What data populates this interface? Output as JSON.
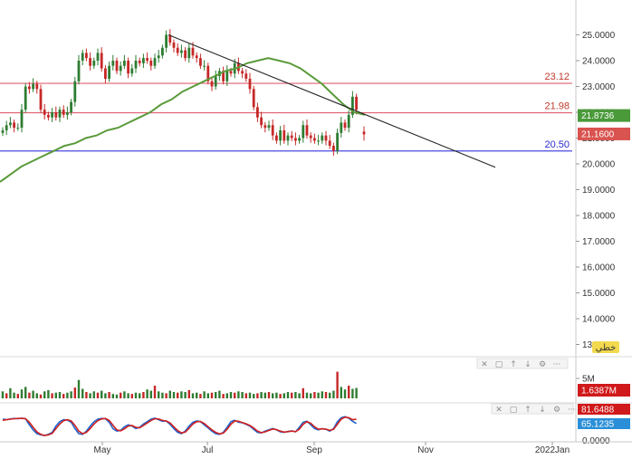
{
  "colors": {
    "candle_up": "#2e7d32",
    "candle_down": "#c62828",
    "ma_line": "#5a9a3a",
    "trend_line": "#222222",
    "resistance": "#e06070",
    "support": "#4a4ae0",
    "stoch_k": "#1e66d0",
    "stoch_d": "#d02020",
    "tag_ma": "#4a9a3a",
    "tag_price": "#d9534f",
    "tag_vol": "#d0191a",
    "tag_stoch1": "#d0191a",
    "tag_stoch2": "#2a8fd8"
  },
  "toolbar": {
    "mode_label": "خطي",
    "icons": [
      "close-icon",
      "maximize-icon",
      "move-up-icon",
      "move-down-icon",
      "settings-icon",
      "more-icon"
    ]
  },
  "chart_data": [
    {
      "type": "candlestick",
      "title": "",
      "ylim": [
        12.8,
        25.6
      ],
      "y_ticks": [
        "25.0000",
        "24.0000",
        "23.0000",
        "22.0000",
        "21.0000",
        "20.0000",
        "19.0000",
        "18.0000",
        "17.0000",
        "16.0000",
        "15.0000",
        "14.0000",
        "13.0000"
      ],
      "y_tick_values": [
        25,
        24,
        23,
        22,
        21,
        20,
        19,
        18,
        17,
        16,
        15,
        14,
        13
      ],
      "x_ticks": [
        "May",
        "Jul",
        "Sep",
        "Nov",
        "2022Jan"
      ],
      "series": [
        {
          "name": "",
          "kind": "ohlc",
          "close": [
            21.3,
            21.5,
            21.6,
            21.4,
            21.4,
            22.1,
            23.0,
            22.9,
            23.1,
            22.9,
            22.1,
            21.9,
            21.8,
            22.0,
            21.8,
            22.1,
            21.9,
            22.0,
            22.4,
            23.2,
            24.0,
            24.3,
            24.1,
            23.8,
            24.0,
            24.3,
            23.7,
            23.3,
            23.8,
            24.0,
            23.6,
            23.8,
            24.0,
            23.5,
            23.7,
            24.0,
            23.9,
            24.1,
            24.0,
            23.8,
            24.1,
            24.2,
            24.5,
            25.0,
            24.7,
            24.5,
            24.3,
            24.4,
            24.1,
            24.5,
            24.2,
            24.1,
            23.8,
            23.8,
            23.2,
            23.0,
            23.4,
            23.6,
            23.2,
            23.6,
            23.5,
            23.9,
            23.6,
            23.5,
            23.3,
            22.9,
            22.2,
            21.8,
            21.5,
            21.4,
            21.5,
            21.1,
            20.9,
            21.3,
            20.9,
            21.1,
            21.0,
            20.9,
            21.0,
            21.5,
            21.1,
            21.0,
            20.9,
            20.9,
            21.1,
            20.9,
            20.7,
            20.5,
            21.2,
            21.6,
            21.4,
            21.9,
            22.6,
            22.1
          ],
          "last": 21.16
        },
        {
          "name": "",
          "kind": "moving_average",
          "values": [
            19.3,
            19.6,
            19.9,
            20.1,
            20.3,
            20.5,
            20.7,
            20.8,
            21.0,
            21.1,
            21.3,
            21.4,
            21.6,
            21.8,
            22.0,
            22.3,
            22.5,
            22.8,
            23.0,
            23.2,
            23.4,
            23.6,
            23.7,
            23.9,
            24.0,
            24.1,
            24.0,
            23.9,
            23.7,
            23.4,
            23.1,
            22.7,
            22.3,
            22.0,
            21.9
          ],
          "last": 21.8736
        },
        {
          "name": "",
          "kind": "trend_line",
          "points": [
            {
              "x": "2021-06-07",
              "y": 25.0
            },
            {
              "x": "2021-10-25",
              "y": 19.8
            }
          ]
        }
      ],
      "annotations": [
        {
          "label": "23.12",
          "value": 23.12,
          "kind": "resistance"
        },
        {
          "label": "21.98",
          "value": 21.98,
          "kind": "resistance"
        },
        {
          "label": "20.50",
          "value": 20.5,
          "kind": "support"
        }
      ],
      "tags": [
        "21.8736",
        "21.1600"
      ]
    },
    {
      "type": "bar",
      "title": "",
      "ylim": [
        0,
        6
      ],
      "y_ticks": [
        "5M"
      ],
      "series": [
        {
          "name": "",
          "values": [
            1.1,
            0.8,
            1.6,
            0.9,
            0.7,
            1.4,
            1.8,
            0.9,
            1.2,
            0.8,
            0.6,
            1.1,
            1.3,
            0.8,
            0.9,
            1.0,
            0.7,
            0.9,
            1.1,
            1.7,
            2.9,
            1.5,
            1.0,
            0.8,
            1.1,
            0.9,
            1.2,
            0.8,
            1.0,
            0.7,
            0.6,
            0.9,
            1.1,
            0.8,
            0.7,
            0.9,
            0.8,
            1.0,
            1.4,
            1.2,
            2.0,
            1.1,
            0.9,
            0.8,
            1.2,
            1.0,
            0.9,
            1.1,
            1.0,
            1.3,
            0.8,
            0.9,
            0.7,
            1.1,
            0.8,
            0.9,
            1.0,
            1.2,
            0.7,
            0.8,
            1.0,
            0.9,
            1.1,
            1.0,
            0.8,
            0.9,
            0.7,
            0.8,
            1.0,
            0.9,
            1.0,
            0.8,
            0.9,
            0.7,
            0.8,
            1.0,
            0.9,
            1.0,
            0.8,
            1.6,
            0.9,
            0.8,
            1.0,
            0.9,
            1.1,
            1.0,
            0.9,
            1.2,
            4.2,
            1.8,
            1.4,
            2.0,
            1.5,
            1.64
          ]
        }
      ],
      "tags": [
        "1.6387M"
      ]
    },
    {
      "type": "line",
      "title": "",
      "ylim": [
        0,
        100
      ],
      "y_ticks": [
        "0.0000"
      ],
      "series": [
        {
          "name": "",
          "values": [
            82,
            80,
            83,
            85,
            84,
            86,
            84,
            60,
            40,
            25,
            20,
            18,
            22,
            30,
            55,
            72,
            80,
            79,
            70,
            45,
            25,
            22,
            35,
            55,
            72,
            82,
            85,
            84,
            70,
            45,
            35,
            38,
            52,
            60,
            55,
            45,
            50,
            63,
            72,
            82,
            86,
            80,
            74,
            75,
            62,
            45,
            30,
            25,
            35,
            55,
            70,
            75,
            72,
            60,
            48,
            35,
            25,
            22,
            30,
            50,
            72,
            78,
            70,
            68,
            62,
            55,
            42,
            30,
            28,
            35,
            40,
            45,
            40,
            32,
            30,
            34,
            36,
            32,
            50,
            70,
            74,
            60,
            45,
            40,
            45,
            42,
            35,
            45,
            72,
            88,
            92,
            86,
            74,
            65
          ]
        },
        {
          "name": "",
          "values": [
            78,
            80,
            82,
            84,
            85,
            85,
            84,
            70,
            50,
            32,
            22,
            18,
            20,
            26,
            45,
            63,
            76,
            80,
            75,
            58,
            35,
            25,
            30,
            45,
            63,
            76,
            83,
            85,
            77,
            58,
            40,
            36,
            44,
            55,
            57,
            50,
            48,
            57,
            67,
            77,
            84,
            83,
            77,
            75,
            67,
            52,
            37,
            28,
            31,
            46,
            63,
            72,
            73,
            65,
            52,
            40,
            30,
            24,
            27,
            42,
            62,
            75,
            74,
            69,
            64,
            57,
            47,
            35,
            29,
            32,
            38,
            43,
            41,
            35,
            31,
            33,
            35,
            33,
            43,
            62,
            72,
            66,
            52,
            43,
            44,
            43,
            38,
            42,
            62,
            82,
            90,
            88,
            80,
            81.6488
          ]
        }
      ],
      "tags": [
        "81.6488",
        "65.1235"
      ]
    }
  ]
}
